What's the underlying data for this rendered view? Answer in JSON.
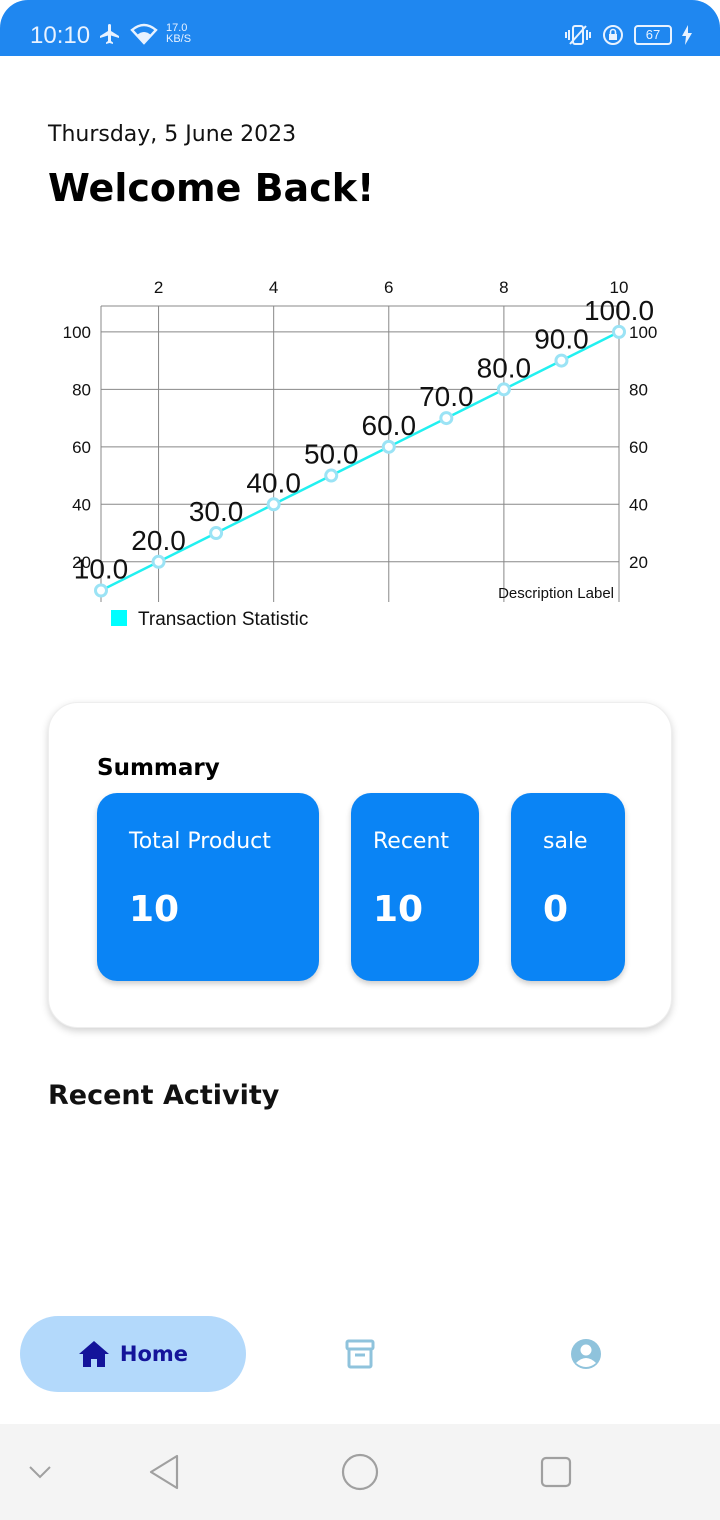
{
  "status_bar": {
    "time": "10:10",
    "net_speed_value": "17.0",
    "net_speed_unit": "KB/S",
    "battery": "67",
    "icons": [
      "airplane-icon",
      "wifi-icon",
      "vibrate-icon",
      "lock-rotation-icon",
      "battery-icon",
      "charging-icon"
    ]
  },
  "header": {
    "date": "Thursday, 5 June 2023",
    "welcome": "Welcome Back!"
  },
  "chart_data": {
    "type": "line",
    "x": [
      1,
      2,
      3,
      4,
      5,
      6,
      7,
      8,
      9,
      10
    ],
    "series": [
      {
        "name": "Transaction Statistic",
        "values": [
          10,
          20,
          30,
          40,
          50,
          60,
          70,
          80,
          90,
          100
        ],
        "color": "#22f0f0"
      }
    ],
    "point_labels": [
      "10.0",
      "20.0",
      "30.0",
      "40.0",
      "50.0",
      "60.0",
      "70.0",
      "80.0",
      "90.0",
      "100.0"
    ],
    "x_ticks": [
      "2",
      "4",
      "6",
      "8",
      "10"
    ],
    "y_ticks": [
      "20",
      "40",
      "60",
      "80",
      "100"
    ],
    "x_axis_position": "top",
    "y_axes": [
      "left",
      "right"
    ],
    "xlim": [
      1,
      10
    ],
    "ylim": [
      6,
      109
    ],
    "grid": true,
    "description": "Description Label",
    "legend": {
      "label": "Transaction Statistic",
      "color": "#00ffff",
      "position": "bottom-left"
    }
  },
  "summary": {
    "title": "Summary",
    "tiles": [
      {
        "label": "Total Product",
        "value": "10"
      },
      {
        "label": "Recent",
        "value": "10"
      },
      {
        "label": "sale",
        "value": "0"
      }
    ]
  },
  "recent": {
    "title": "Recent Activity"
  },
  "bottom_nav": {
    "home_label": "Home",
    "items": [
      "home-icon",
      "archive-icon",
      "profile-icon"
    ]
  },
  "system_nav": [
    "chevron-down-icon",
    "back-icon",
    "home-circle-icon",
    "recents-icon"
  ]
}
